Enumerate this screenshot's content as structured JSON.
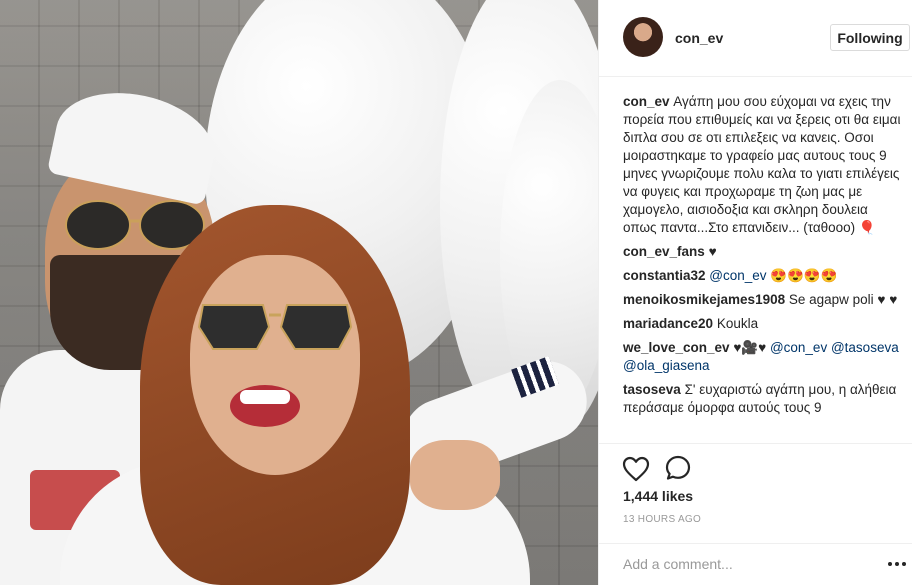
{
  "post": {
    "username": "con_ev",
    "follow_label": "Following",
    "likes": "1,444 likes",
    "time": "13 HOURS AGO",
    "add_comment_placeholder": "Add a comment...",
    "photo_alt": "couple with white balloons"
  },
  "caption": {
    "user": "con_ev",
    "text": "Αγάπη μου σου εύχομαι να εχεις την πορεία που επιθυμείς και να ξερεις οτι θα ειμαι διπλα σου σε οτι επιλεξεις να κανεις. Οσοι μοιραστηκαμε το γραφείο μας αυτους τους 9 μηνες γνωριζουμε πολυ καλα το γιατι επιλέγεις να φυγεις και προχωραμε τη ζωη μας με χαμογελο, αισιοδοξια και σκληρη δουλεια οπως παντα...Στο επανιδειν... (ταθοοο) 🎈"
  },
  "comments": [
    {
      "user": "con_ev_fans",
      "text": "♥"
    },
    {
      "user": "constantia32",
      "mention": "@con_ev",
      "text": "😍😍😍😍"
    },
    {
      "user": "menoikosmikejames1908",
      "text": "Se agapw poli ♥ ♥"
    },
    {
      "user": "mariadance20",
      "text": "Koukla"
    },
    {
      "user": "we_love_con_ev",
      "text": "♥🎥♥",
      "mention": "@con_ev",
      "mention2": "@tasoseva",
      "mention3": "@ola_giasena"
    },
    {
      "user": "tasoseva",
      "text": "Σ' ευχαριστώ αγάπη μου, η αλήθεια περάσαμε όμορφα αυτούς τους 9"
    }
  ],
  "icons": {
    "like": "heart-outline-icon",
    "comment": "speech-bubble-icon",
    "more": "more-options-icon"
  },
  "colors": {
    "mention": "#003569",
    "meta": "#999999",
    "border": "#efefef"
  }
}
